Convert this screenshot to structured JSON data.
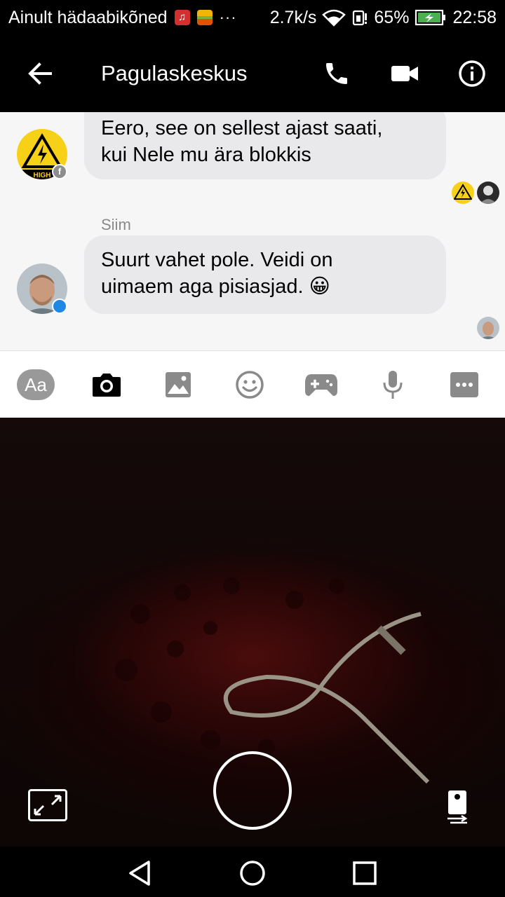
{
  "status_bar": {
    "carrier": "Ainult hädaabikõned",
    "dots": "···",
    "speed": "2.7k/s",
    "battery": "65%",
    "time": "22:58"
  },
  "header": {
    "title": "Pagulaskeskus"
  },
  "messages": [
    {
      "sender": "",
      "lines": [
        "Eero, see on sellest ajast saati,",
        "kui Nele mu ära blokkis"
      ]
    },
    {
      "sender": "Siim",
      "lines": [
        "Suurt vahet pole. Veidi on",
        "uimaem aga pisiasjad."
      ],
      "emoji": "😀"
    }
  ],
  "composer": {
    "aa_label": "Aa"
  },
  "colors": {
    "accent": "#1e88e5",
    "bubble": "#e9e9eb",
    "avatar_yellow": "#f7d117"
  }
}
